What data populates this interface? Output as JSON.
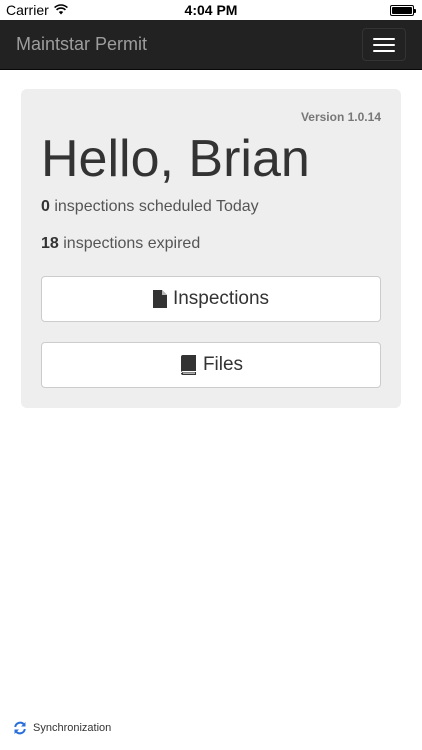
{
  "status_bar": {
    "carrier": "Carrier",
    "time": "4:04 PM",
    "icons": [
      "wifi-icon",
      "battery-icon"
    ]
  },
  "navbar": {
    "brand": "Maintstar Permit",
    "menu_icon": "hamburger-icon",
    "background": "#222222"
  },
  "main": {
    "version": "Version 1.0.14",
    "greeting": "Hello, Brian",
    "stats": [
      {
        "count": "0",
        "text": " inspections scheduled Today"
      },
      {
        "count": "18",
        "text": " inspections expired"
      }
    ],
    "buttons": [
      {
        "label": "Inspections",
        "icon": "file-icon"
      },
      {
        "label": "Files",
        "icon": "book-icon"
      }
    ],
    "card_background": "#eeeeee"
  },
  "footer": {
    "sync_label": "Synchronization",
    "sync_icon": "refresh-icon",
    "sync_color": "#2a6fdb"
  }
}
